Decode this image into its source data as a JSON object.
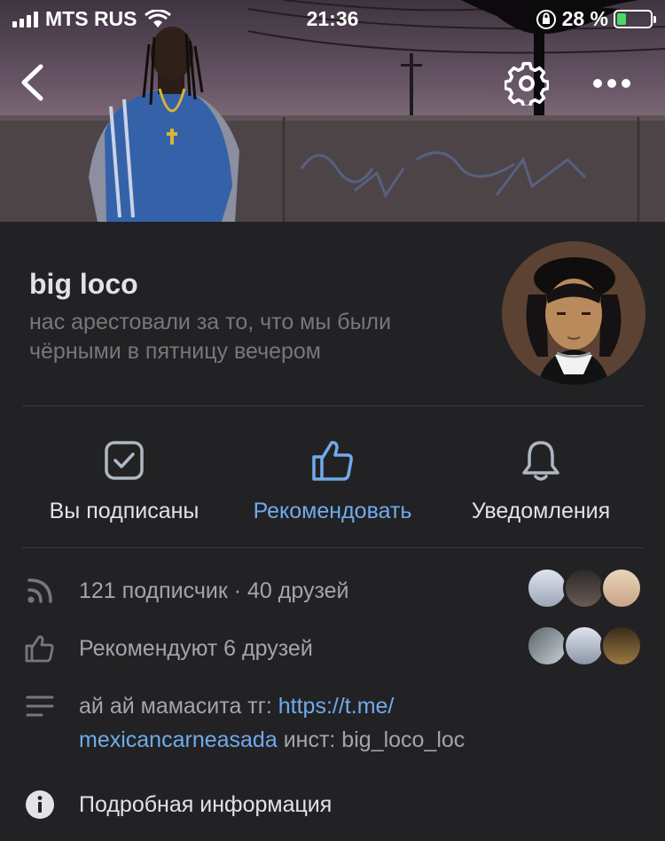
{
  "status_bar": {
    "carrier": "MTS RUS",
    "time": "21:36",
    "battery": "28 %"
  },
  "nav": {
    "back_icon": "chevron-left-icon",
    "settings_icon": "gear-icon",
    "more_icon": "more-horizontal-icon"
  },
  "profile": {
    "name": "big loco",
    "status": "нас арестовали за то, что мы были чёрными в пятницу вечером"
  },
  "actions": [
    {
      "label": "Вы подписаны",
      "icon": "checkbox-icon"
    },
    {
      "label": "Рекомендовать",
      "icon": "thumbs-up-icon"
    },
    {
      "label": "Уведомления",
      "icon": "bell-icon"
    }
  ],
  "info": {
    "followers": "121 подписчик · 40 друзей",
    "recommend": "Рекомендуют 6 друзей",
    "about_prefix": "ай ай мамасита тг: ",
    "about_link_1": "https://t.me/",
    "about_link_2": "mexicancarneasada",
    "about_suffix": " инст: big_loco_loc",
    "more": "Подробная информация"
  },
  "colors": {
    "accent": "#71aaeb",
    "background": "#19191a",
    "card": "#222224",
    "secondary_text": "#76787a"
  }
}
